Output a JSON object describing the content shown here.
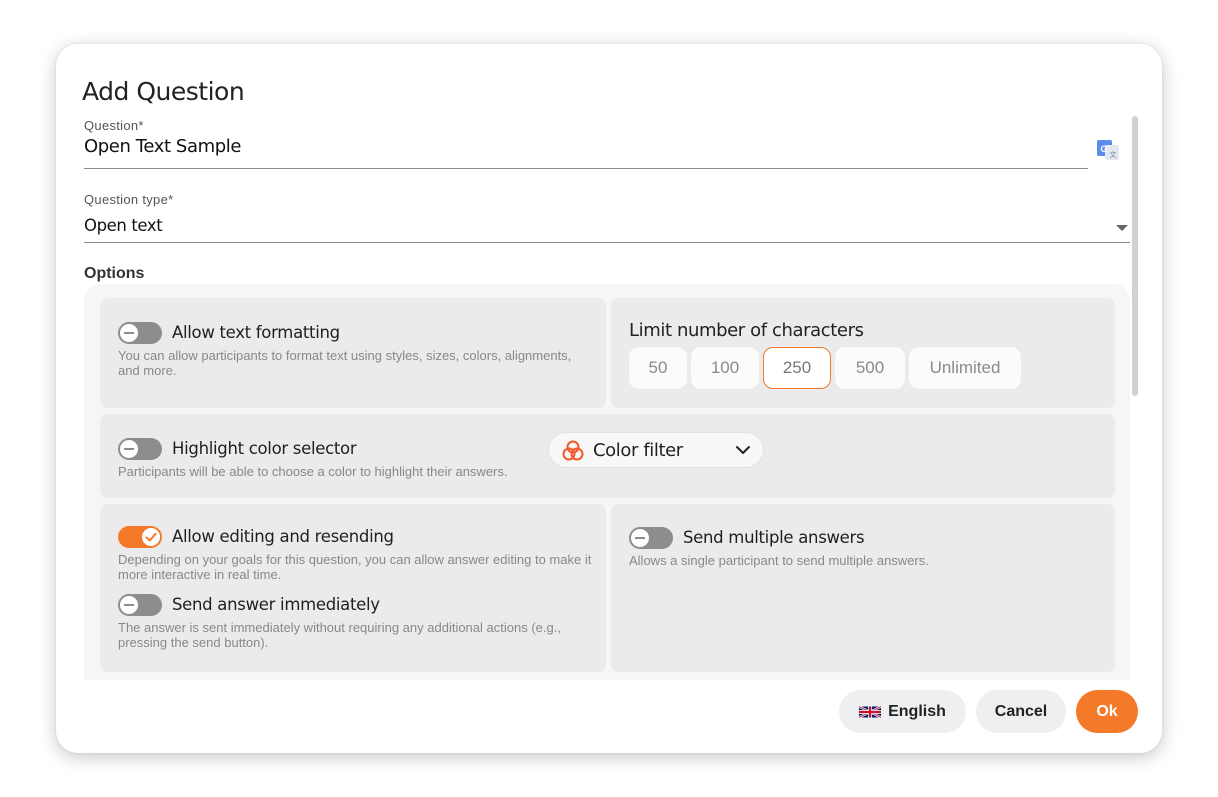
{
  "dialog": {
    "title": "Add Question"
  },
  "question_field": {
    "label": "Question*",
    "value": "Open Text Sample",
    "icon": "translate-icon"
  },
  "type_field": {
    "label": "Question type*",
    "value": "Open text",
    "icon": "dropdown-arrow-icon"
  },
  "options": {
    "heading": "Options",
    "text_formatting": {
      "label": "Allow text formatting",
      "description": "You can allow participants to format text using styles, sizes, colors, alignments, and more.",
      "enabled": false
    },
    "limit_characters": {
      "label": "Limit number of characters",
      "choices": [
        "50",
        "100",
        "250",
        "500",
        "Unlimited"
      ],
      "selected": "250"
    },
    "highlight_color": {
      "label": "Highlight color selector",
      "description": "Participants will be able to choose a color to highlight their answers.",
      "enabled": false
    },
    "color_filter": {
      "label": "Color filter",
      "icon": "color-filter-icon"
    },
    "editing_resending": {
      "label": "Allow editing and resending",
      "description": "Depending on your goals for this question, you can allow answer editing to make it more interactive in real time.",
      "enabled": true
    },
    "send_immediately": {
      "label": "Send answer immediately",
      "description": "The answer is sent immediately without requiring any additional actions (e.g., pressing the send button).",
      "enabled": false
    },
    "multiple_answers": {
      "label": "Send multiple answers",
      "description": "Allows a single participant to send multiple answers.",
      "enabled": false
    }
  },
  "footer": {
    "language_label": "English",
    "language_icon": "uk-flag-icon",
    "cancel_label": "Cancel",
    "ok_label": "Ok"
  },
  "colors": {
    "accent": "#f47a2a",
    "toggle_off": "#8d8d8d",
    "card_bg": "#ebebee"
  }
}
